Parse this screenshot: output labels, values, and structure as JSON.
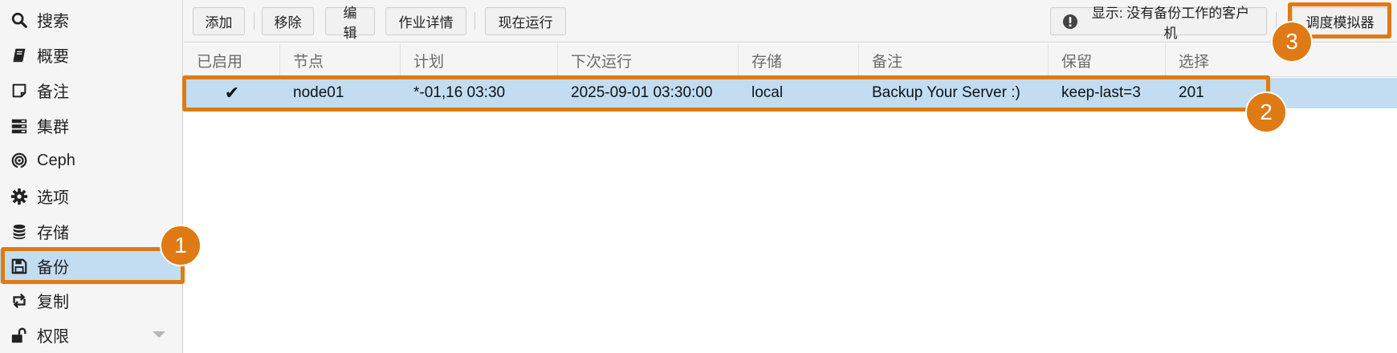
{
  "sidebar": {
    "items": [
      {
        "label": "搜索",
        "icon": "search-icon"
      },
      {
        "label": "概要",
        "icon": "book-icon"
      },
      {
        "label": "备注",
        "icon": "note-icon"
      },
      {
        "label": "集群",
        "icon": "server-icon"
      },
      {
        "label": "Ceph",
        "icon": "ceph-icon"
      },
      {
        "label": "选项",
        "icon": "gear-icon"
      },
      {
        "label": "存储",
        "icon": "database-icon"
      },
      {
        "label": "备份",
        "icon": "floppy-icon",
        "active": true
      },
      {
        "label": "复制",
        "icon": "retweet-icon"
      },
      {
        "label": "权限",
        "icon": "unlock-icon"
      }
    ]
  },
  "toolbar": {
    "add": "添加",
    "remove": "移除",
    "edit": "编辑",
    "job_detail": "作业详情",
    "run_now": "现在运行",
    "show_guests": "显示: 没有备份工作的客户机",
    "schedule_sim": "调度模拟器"
  },
  "grid": {
    "columns": [
      "已启用",
      "节点",
      "计划",
      "下次运行",
      "存储",
      "备注",
      "保留",
      "选择"
    ],
    "rows": [
      {
        "enabled": "✔",
        "node": "node01",
        "schedule": "*-01,16 03:30",
        "next_run": "2025-09-01 03:30:00",
        "storage": "local",
        "comment": "Backup Your Server :)",
        "retention": "keep-last=3",
        "selection": "201"
      }
    ]
  },
  "callouts": [
    "1",
    "2",
    "3"
  ],
  "colors": {
    "accent": "#e07a14",
    "selected": "#c2ddf2"
  }
}
